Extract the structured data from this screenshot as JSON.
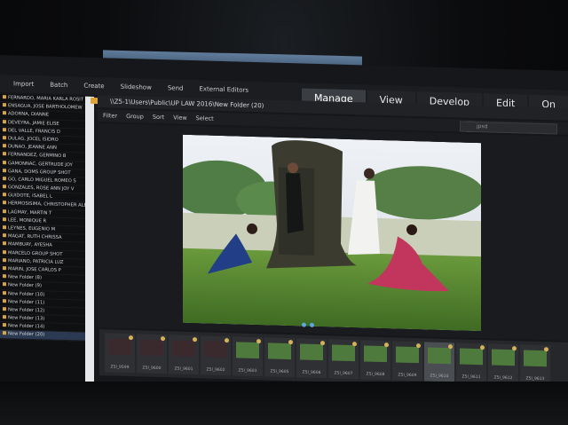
{
  "menubar": {
    "items": [
      "Import",
      "Batch",
      "Create",
      "Slideshow",
      "Send",
      "External Editors"
    ]
  },
  "modes": {
    "tabs": [
      "Manage",
      "View",
      "Develop",
      "Edit",
      "On"
    ],
    "active": "Manage"
  },
  "pathbar": {
    "path": "\\\\Z5-1\\Users\\Public\\UP LAW 2016\\New Folder (20)"
  },
  "toolbar": {
    "items": [
      "Filter",
      "Group",
      "Sort",
      "View",
      "Select"
    ],
    "search_placeholder": "jpsd"
  },
  "sidebar": {
    "items": [
      "FERNARDO, MARIA KARLA ROSIT",
      "ENSAGUA, JOSE BARTHOLOMEW",
      "ADORNA, DIANNE",
      "DEVEYRA, JAMIE ELISE",
      "DEL VALLE, FRANCIS D",
      "DULAG, JOCEL ISIDRO",
      "DUNAO, JEANNE ANN",
      "FERNANDEZ, GERMINO B",
      "GAMONNAC, GERTRUDE JOY",
      "GANA, DOMS GROUP SHOT",
      "GO, CARLO MIGUEL ROMEO S",
      "GONZALES, ROSE ANN JOY V",
      "GUIDOTE, ISABEL L",
      "HERMOSISIMA, CHRISTOPHER ALE",
      "LAGMAY, MARTIN T",
      "LEE, MONIQUE R",
      "LEYNES, EUGENIO M",
      "MAGAT, RUTH CHRISSA",
      "MAMBUAY, AYESHA",
      "MARCELO GROUP SHOT",
      "MARIANO, PATRICIA LUZ",
      "MARIN, JOSE CARLOS P",
      "New Folder (8)",
      "New Folder (9)",
      "New Folder (10)",
      "New Folder (11)",
      "New Folder (12)",
      "New Folder (13)",
      "New Folder (14)",
      "New Folder (20)"
    ]
  },
  "filmstrip": {
    "thumbs": [
      {
        "label": "Z5I_9599"
      },
      {
        "label": "Z5I_9600"
      },
      {
        "label": "Z5I_9601"
      },
      {
        "label": "Z5I_9602"
      },
      {
        "label": "Z5I_9603"
      },
      {
        "label": "Z5I_9605"
      },
      {
        "label": "Z5I_9606"
      },
      {
        "label": "Z5I_9607"
      },
      {
        "label": "Z5I_9608"
      },
      {
        "label": "Z5I_9609"
      },
      {
        "label": "Z5I_9610"
      },
      {
        "label": "Z5I_9611"
      },
      {
        "label": "Z5I_9612"
      },
      {
        "label": "Z5I_9613"
      }
    ],
    "selected_index": 10
  },
  "colors": {
    "accent": "#d8a640",
    "active_tab": "#3a3d42",
    "dot": "#5aa8e0"
  }
}
